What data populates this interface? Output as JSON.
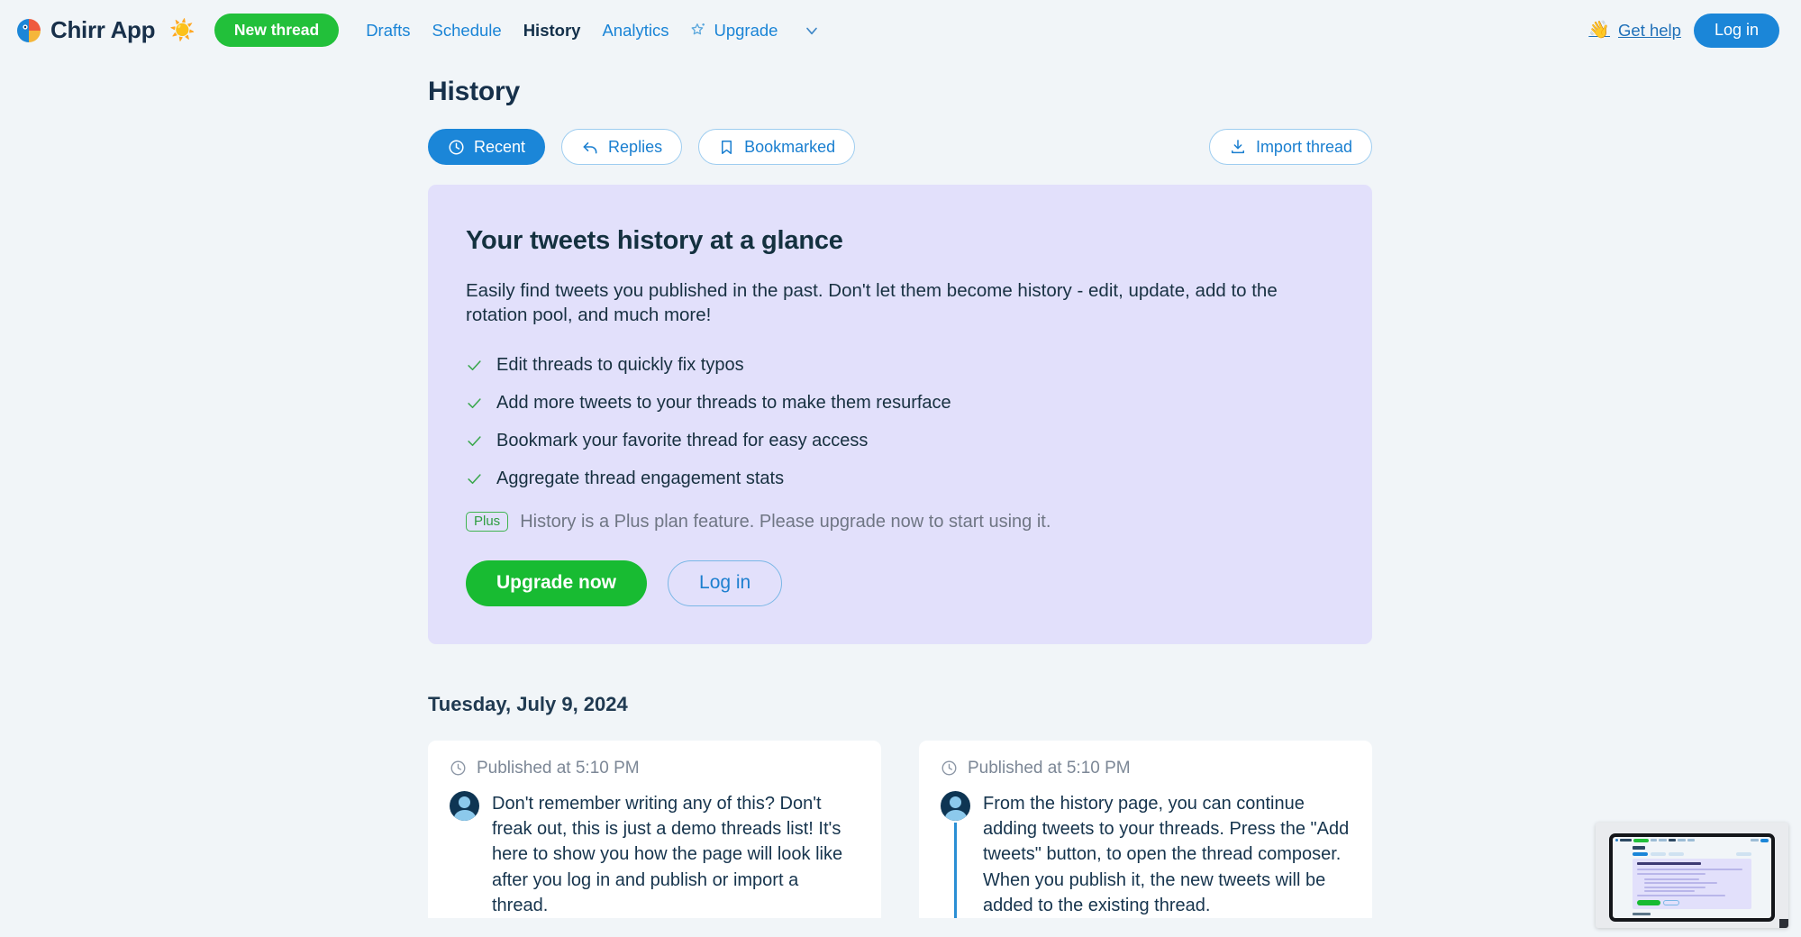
{
  "header": {
    "brand_name": "Chirr App",
    "logo_icon": "chirr-bird-logo",
    "theme_toggle_icon": "sun-icon",
    "theme_toggle_glyph": "☀️",
    "new_thread_label": "New thread",
    "nav_items": [
      {
        "label": "Drafts",
        "active": false,
        "icon": null
      },
      {
        "label": "Schedule",
        "active": false,
        "icon": null
      },
      {
        "label": "History",
        "active": true,
        "icon": null
      },
      {
        "label": "Analytics",
        "active": false,
        "icon": null
      },
      {
        "label": "Upgrade",
        "active": false,
        "icon": "star-sparkle-icon"
      }
    ],
    "more_chevron_icon": "chevron-down-icon",
    "get_help_label": "Get help",
    "wave_icon": "waving-hand-icon",
    "wave_glyph": "👋",
    "login_label": "Log in"
  },
  "main": {
    "page_title": "History",
    "filters": [
      {
        "label": "Recent",
        "icon": "clock-icon",
        "active": true
      },
      {
        "label": "Replies",
        "icon": "reply-arrow-icon",
        "active": false
      },
      {
        "label": "Bookmarked",
        "icon": "bookmark-icon",
        "active": false
      }
    ],
    "import_label": "Import thread",
    "import_icon": "download-icon"
  },
  "promo": {
    "title": "Your tweets history at a glance",
    "description": "Easily find tweets you published in the past. Don't let them become history - edit, update, add to the rotation pool, and much more!",
    "features": [
      "Edit threads to quickly fix typos",
      "Add more tweets to your threads to make them resurface",
      "Bookmark your favorite thread for easy access",
      "Aggregate thread engagement stats"
    ],
    "plan_badge": "Plus",
    "plan_note": "History is a Plus plan feature. Please upgrade now to start using it.",
    "upgrade_label": "Upgrade now",
    "login_label": "Log in"
  },
  "threads": {
    "date_heading": "Tuesday, July 9, 2024",
    "cards": [
      {
        "published_label": "Published at 5:10 PM",
        "published_icon": "clock-icon",
        "avatar_icon": "user-avatar",
        "has_thread_line": false,
        "text": "Don't remember writing any of this? Don't freak out, this is just a demo threads list! It's here to show you how the page will look like after you log in and publish or import a thread."
      },
      {
        "published_label": "Published at 5:10 PM",
        "published_icon": "clock-icon",
        "avatar_icon": "user-avatar",
        "has_thread_line": true,
        "text": "From the history page, you can continue adding tweets to your threads. Press the \"Add tweets\" button, to open the thread composer. When you publish it, the new tweets will be added to the existing thread."
      }
    ]
  },
  "pip": {
    "name": "screen-preview-thumbnail"
  },
  "colors": {
    "page_background": "#f1f5f8",
    "promo_card_background": "#e2e0fb",
    "accent_blue": "#1b86d8",
    "accent_green": "#22c03a",
    "upgrade_green": "#18bb32",
    "text_dark": "#16344d",
    "muted_text": "#7c8796",
    "plus_green": "#2f9d41"
  }
}
